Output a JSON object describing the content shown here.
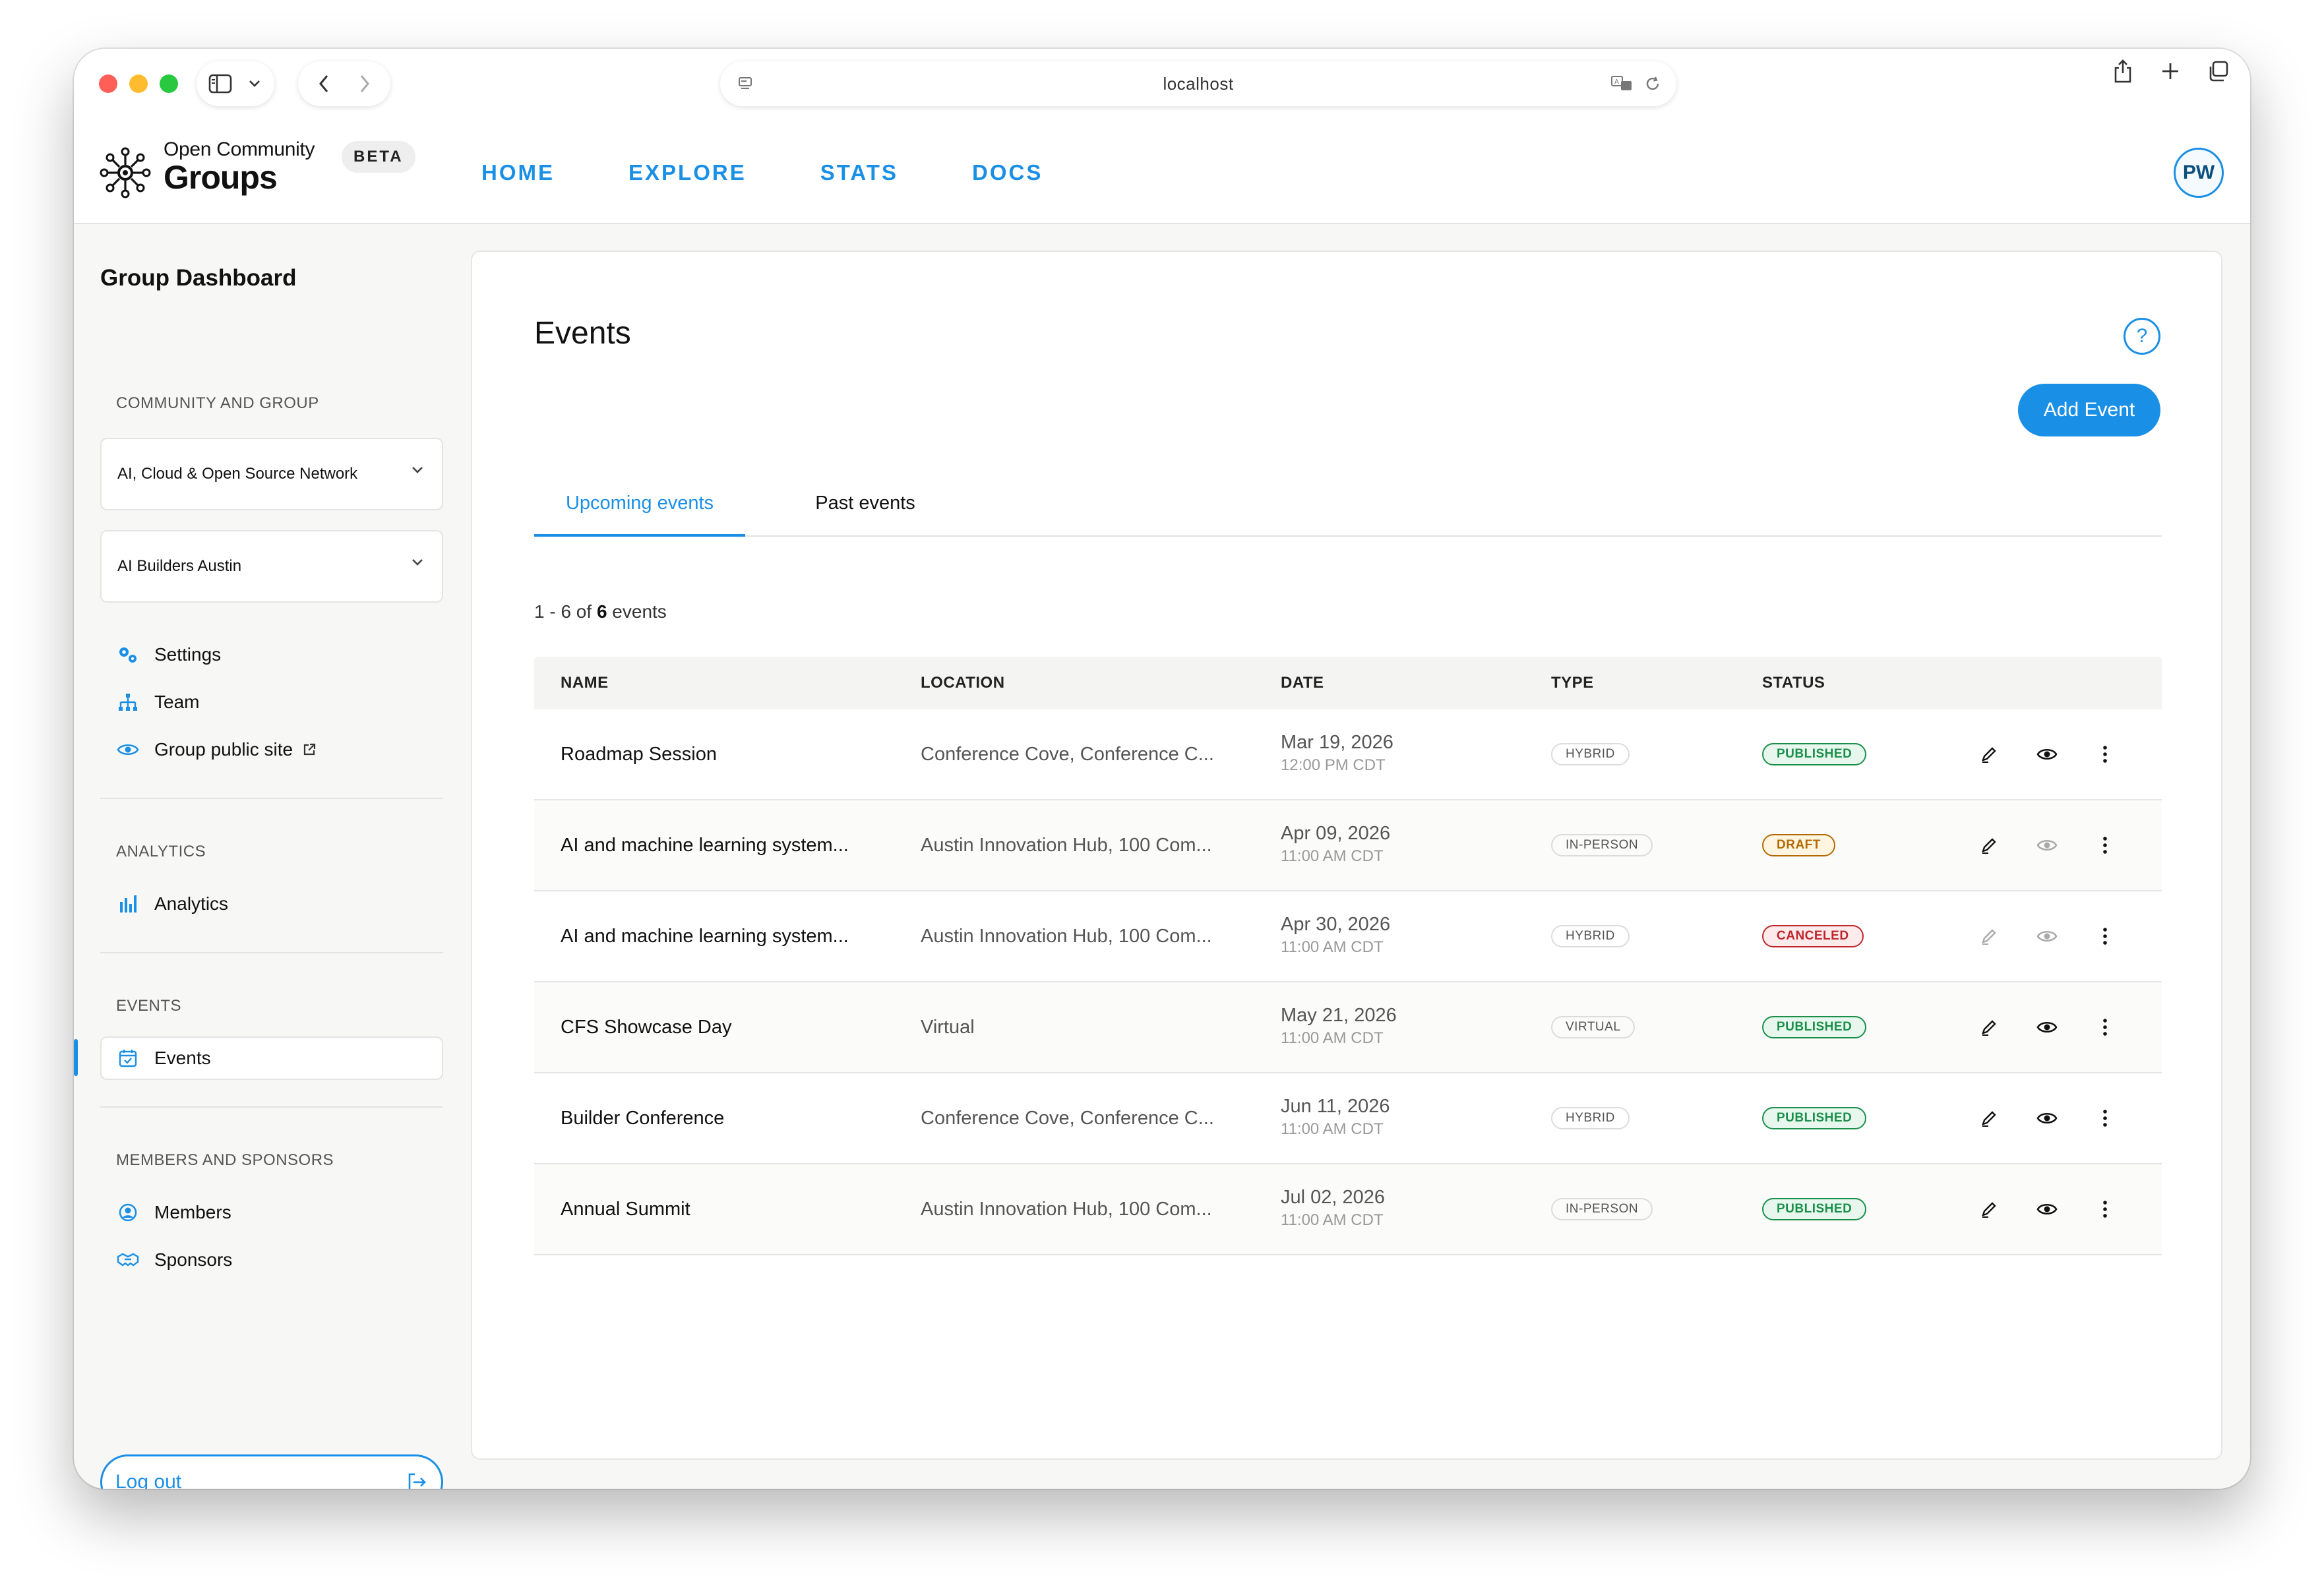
{
  "browser": {
    "address": "localhost"
  },
  "header": {
    "logo_top": "Open Community",
    "logo_bottom": "Groups",
    "beta": "BETA",
    "nav": [
      {
        "label": "HOME"
      },
      {
        "label": "EXPLORE"
      },
      {
        "label": "STATS"
      },
      {
        "label": "DOCS"
      }
    ],
    "avatar_initials": "PW"
  },
  "sidebar": {
    "title": "Group Dashboard",
    "section_community": "COMMUNITY AND GROUP",
    "community_select": "AI, Cloud & Open Source Network",
    "group_select": "AI Builders Austin",
    "group_items": [
      {
        "label": "Settings",
        "icon": "gears-icon"
      },
      {
        "label": "Team",
        "icon": "org-chart-icon"
      },
      {
        "label": "Group public site",
        "icon": "eye-icon"
      }
    ],
    "section_analytics": "ANALYTICS",
    "analytics_label": "Analytics",
    "section_events": "EVENTS",
    "events_label": "Events",
    "section_members": "MEMBERS AND SPONSORS",
    "members_label": "Members",
    "sponsors_label": "Sponsors",
    "logout_label": "Log out"
  },
  "main": {
    "title": "Events",
    "help": "?",
    "add_button": "Add Event",
    "tabs": [
      {
        "label": "Upcoming events",
        "active": true
      },
      {
        "label": "Past events",
        "active": false
      }
    ],
    "count_prefix": "1 - 6 of ",
    "count_total": "6",
    "count_suffix": " events",
    "columns": [
      "NAME",
      "LOCATION",
      "DATE",
      "TYPE",
      "STATUS"
    ],
    "rows": [
      {
        "name": "Roadmap Session",
        "location": "Conference Cove, Conference C...",
        "date": "Mar 19, 2026",
        "time": "12:00 PM CDT",
        "type": "HYBRID",
        "status": "PUBLISHED"
      },
      {
        "name": "AI and machine learning system...",
        "location": "Austin Innovation Hub, 100 Com...",
        "date": "Apr 09, 2026",
        "time": "11:00 AM CDT",
        "type": "IN-PERSON",
        "status": "DRAFT"
      },
      {
        "name": "AI and machine learning system...",
        "location": "Austin Innovation Hub, 100 Com...",
        "date": "Apr 30, 2026",
        "time": "11:00 AM CDT",
        "type": "HYBRID",
        "status": "CANCELED"
      },
      {
        "name": "CFS Showcase Day",
        "location": "Virtual",
        "date": "May 21, 2026",
        "time": "11:00 AM CDT",
        "type": "VIRTUAL",
        "status": "PUBLISHED"
      },
      {
        "name": "Builder Conference",
        "location": "Conference Cove, Conference C...",
        "date": "Jun 11, 2026",
        "time": "11:00 AM CDT",
        "type": "HYBRID",
        "status": "PUBLISHED"
      },
      {
        "name": "Annual Summit",
        "location": "Austin Innovation Hub, 100 Com...",
        "date": "Jul 02, 2026",
        "time": "11:00 AM CDT",
        "type": "IN-PERSON",
        "status": "PUBLISHED"
      }
    ]
  },
  "colors": {
    "accent": "#1a8fe6",
    "published": "#1a8f4a",
    "draft": "#b26a00",
    "canceled": "#c0262d"
  }
}
